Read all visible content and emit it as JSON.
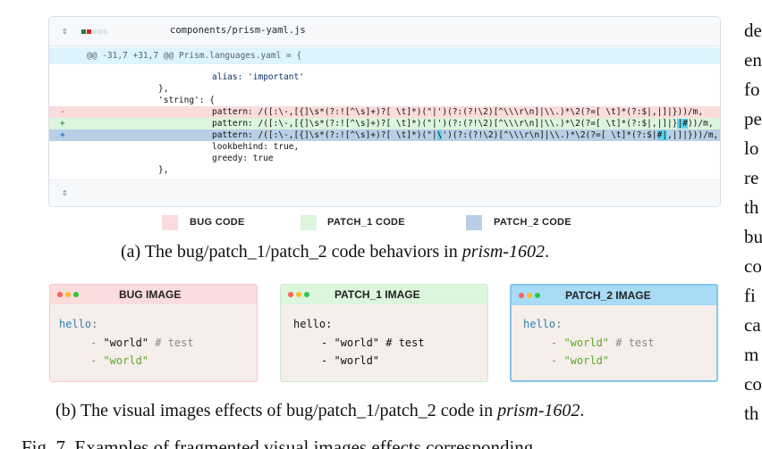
{
  "diff": {
    "expand_icon": "⇕",
    "filename": "components/prism-yaml.js",
    "hunk": "@@ -31,7 +31,7 @@ Prism.languages.yaml = {",
    "lines": {
      "l1": "alias: 'important'",
      "l2": "},",
      "l3": "'string': {",
      "del_marker": "-",
      "del_code": "pattern: /([:\\-,[{]\\s*(?:![^\\s]+)?[ \\t]*)(\"|')(?:(?!\\2)[^\\\\\\r\\n]|\\\\.)*\\2(?=[ \\t]*(?:$|,|]|}))/m,",
      "add1_marker": "+",
      "add1_code_a": "pattern: /([:\\-,[{]\\s*(?:![^\\s]+)?[ \\t]*)(\"|')(?:(?!\\2)[^\\\\\\r\\n]|\\\\.)*\\2(?=[ \\t]*(?:$|,|]|}",
      "add1_code_hl": "|#",
      "add1_code_b": "))/m,",
      "add2_marker": "+",
      "add2_code_a": "pattern: /([:\\-,[{]\\s*(?:![^\\s]+)?[ \\t]*)(\"|",
      "add2_code_hl1": "\\",
      "add2_code_b": "')(?:(?!\\2)[^\\\\\\r\\n]|\\\\.)*\\2(?=[ \\t]*(?:$|",
      "add2_code_hl2": "#|",
      "add2_code_c": ",|]|}))/m,",
      "l7": "lookbehind: true,",
      "l8": "greedy: true",
      "l9": "},"
    },
    "footer_icon": "⇕"
  },
  "legend": {
    "bug": "BUG CODE",
    "patch1": "PATCH_1 CODE",
    "patch2": "PATCH_2 CODE"
  },
  "caption_a": {
    "prefix": "(a) The bug/patch_1/patch_2 code behaviors in ",
    "name": "prism-1602",
    "suffix": "."
  },
  "cards": {
    "bug": {
      "title": "BUG IMAGE",
      "line1_key": "hello",
      "line1_colon": ":",
      "line2_dash": "- ",
      "line2_str": "\"world\"",
      "line2_comment": " # test",
      "line3_dash": "- ",
      "line3_str": "\"world\""
    },
    "patch1": {
      "title": "PATCH_1 IMAGE",
      "line1": "hello:",
      "line2_dash": "- ",
      "line2_str": "\"world\"",
      "line2_comment": " # test",
      "line3_dash": "- ",
      "line3_str": "\"world\""
    },
    "patch2": {
      "title": "PATCH_2 IMAGE",
      "line1_key": "hello",
      "line1_colon": ":",
      "line2_dash": "- ",
      "line2_str": "\"world\"",
      "line2_comment": " # test",
      "line3_dash": "- ",
      "line3_str": "\"world\""
    }
  },
  "caption_b": {
    "prefix": "(b) The visual images effects of bug/patch_1/patch_2 code in ",
    "name": "prism-1602",
    "suffix": "."
  },
  "side_text": [
    "de",
    "en",
    "fo",
    "pe",
    "lo",
    "re",
    "th",
    "bu",
    "co",
    "fi",
    "ca",
    "m",
    "co",
    "th"
  ],
  "bottom_text": "Fig. 7. Examples of fragmented visual images effects corresponding",
  "colors": {
    "bug_bg": "#fbdcdc",
    "patch1_bg": "#dcf5dd",
    "patch2_bg": "#b9cfe6",
    "highlight": "#5fd0ea",
    "yaml_key": "#2f7fb0",
    "yaml_string_green": "#5ba82b",
    "yaml_comment": "#8a8a8a"
  }
}
